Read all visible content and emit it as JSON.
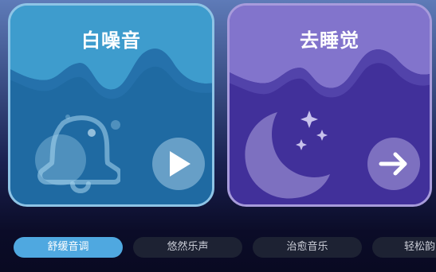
{
  "cards": [
    {
      "title": "白噪音",
      "icon": "bell-icon",
      "action": "play-icon"
    },
    {
      "title": "去睡觉",
      "icon": "moon-stars-icon",
      "action": "arrow-right-icon"
    }
  ],
  "tabs": [
    {
      "label": "舒缓音调",
      "active": true
    },
    {
      "label": "悠然乐声",
      "active": false
    },
    {
      "label": "治愈音乐",
      "active": false
    },
    {
      "label": "轻松韵",
      "active": false
    }
  ],
  "colors": {
    "white_noise_card": "#2c80b5",
    "sleep_card": "#4f3ea6",
    "active_tab": "#4fa8e0",
    "inactive_tab": "#1d2233"
  }
}
